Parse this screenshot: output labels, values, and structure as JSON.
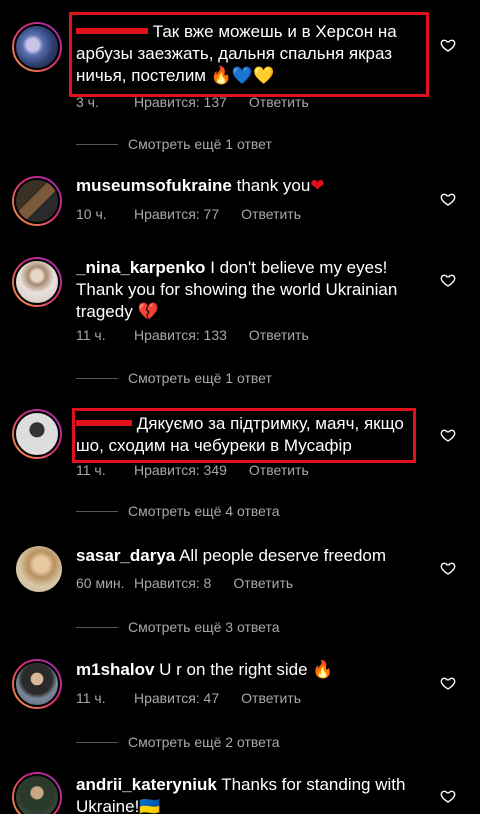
{
  "comments": [
    {
      "username": "",
      "text": "Так вже можешь и в Херсон на арбузы заезжать, дальня спальня якраз ничья, постелим",
      "emoji": [
        "🔥",
        "💙",
        "💛"
      ],
      "time": "3 ч.",
      "likes": "Нравится: 137",
      "reply": "Ответить",
      "more_replies": "Смотреть ещё 1 ответ",
      "highlighted": true
    },
    {
      "username": "museumsofukraine",
      "text": "thank you",
      "emoji": [
        "❤"
      ],
      "time": "10 ч.",
      "likes": "Нравится: 77",
      "reply": "Ответить"
    },
    {
      "username": "_nina_karpenko",
      "text": "I don't believe my eyes! Thank you for showing the world Ukrainian tragedy",
      "emoji": [
        "💔"
      ],
      "time": "11 ч.",
      "likes": "Нравится: 133",
      "reply": "Ответить",
      "more_replies": "Смотреть ещё 1 ответ"
    },
    {
      "username": "",
      "text": "Дякуємо за підтримку, маяч, якщо шо, сходим на чебуреки в Мусафір",
      "time": "11 ч.",
      "likes": "Нравится: 349",
      "reply": "Ответить",
      "more_replies": "Смотреть ещё 4 ответа",
      "highlighted": true
    },
    {
      "username": "sasar_darya",
      "text": "All people deserve freedom",
      "time": "60 мин.",
      "likes": "Нравится: 8",
      "reply": "Ответить",
      "more_replies": "Смотреть ещё 3 ответа"
    },
    {
      "username": "m1shalov",
      "text": "U r on the right side",
      "emoji": [
        "🔥"
      ],
      "time": "11 ч.",
      "likes": "Нравится: 47",
      "reply": "Ответить",
      "more_replies": "Смотреть ещё 2 ответа"
    },
    {
      "username": "andrii_kateryniuk",
      "text": "Thanks for standing with Ukraine!",
      "emoji": [
        "🇺🇦"
      ]
    }
  ],
  "colors": {
    "highlight": "#e0101c",
    "muted_text": "#a8a8a8",
    "background": "#000000"
  },
  "icons": {
    "like": "heart-outline-icon",
    "avatar_ring": "story-ring"
  }
}
